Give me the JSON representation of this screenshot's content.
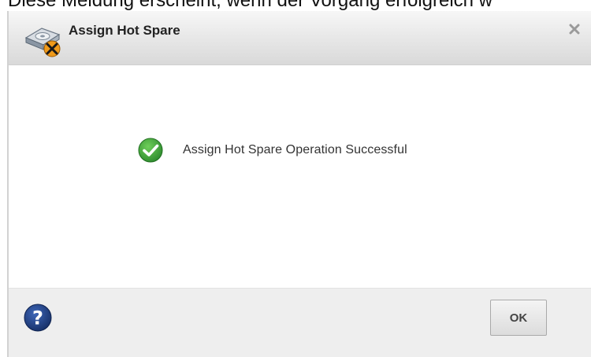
{
  "caption": {
    "text": "Diese Meldung erscheint, wenn der Vorgang erfolgreich w"
  },
  "dialog": {
    "title": "Assign Hot Spare",
    "title_icon": "hot-spare-disk-icon",
    "close_icon": "close-icon",
    "message": "Assign Hot Spare Operation Successful",
    "message_icon": "success-check-icon",
    "help_icon": "help-icon",
    "ok_label": "OK"
  },
  "colors": {
    "success_green": "#3a9a3a",
    "help_blue": "#1f3f7d",
    "titlebar_top": "#f7f7f7",
    "titlebar_bottom": "#d9d9d9",
    "footer_bg": "#eeeeee"
  }
}
